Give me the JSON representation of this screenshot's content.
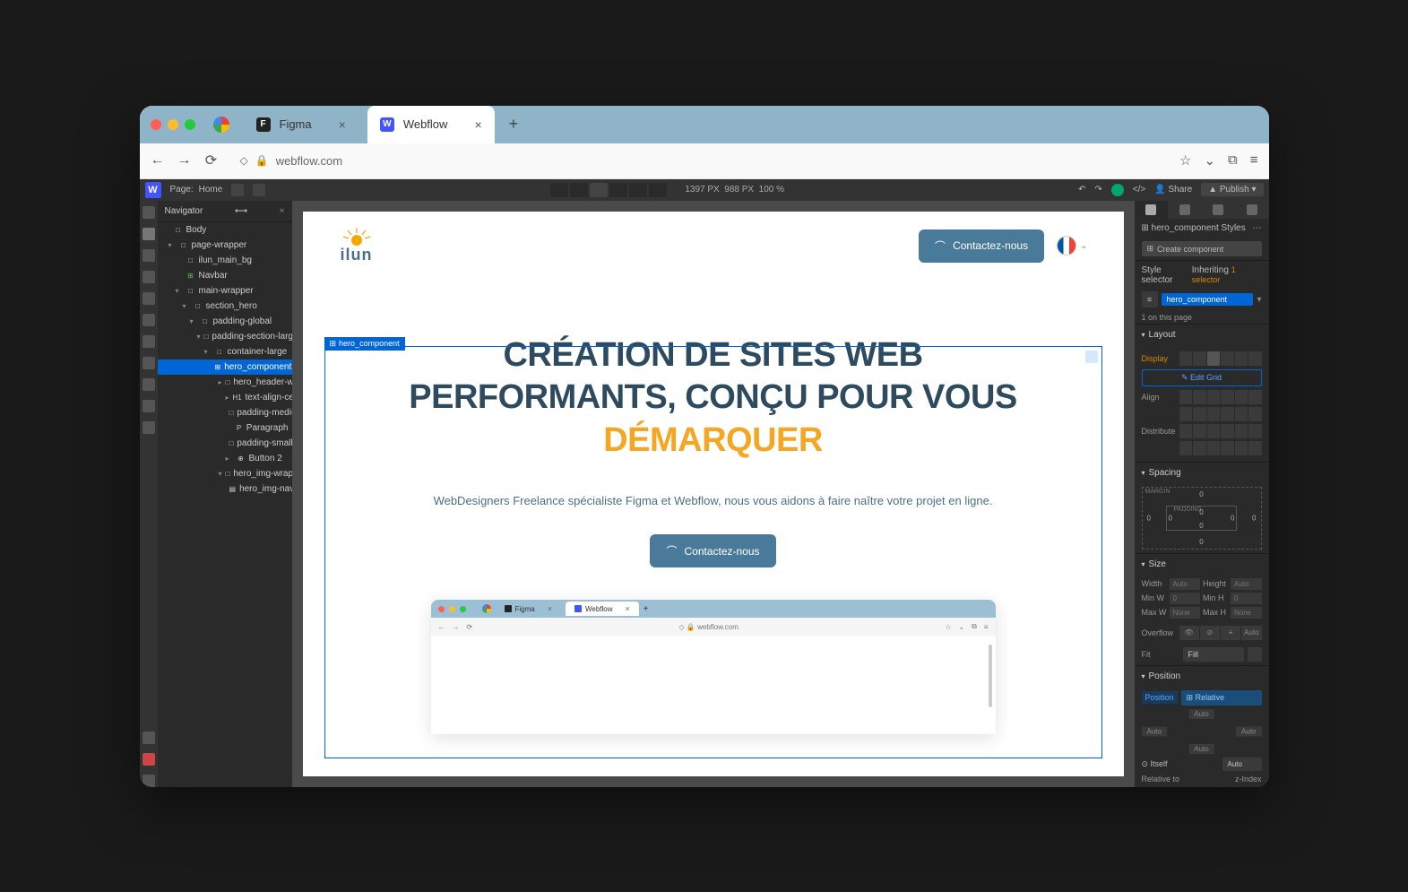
{
  "browser": {
    "tabs": [
      {
        "label": "Figma",
        "favicon_bg": "#222",
        "favicon_letter": "F",
        "active": false
      },
      {
        "label": "Webflow",
        "favicon_bg": "#4353ff",
        "favicon_letter": "W",
        "active": true
      }
    ],
    "url": "webflow.com"
  },
  "wf_topbar": {
    "page_label": "Page:",
    "page_name": "Home",
    "width": "1397",
    "px1": "PX",
    "height": "988",
    "px2": "PX",
    "zoom": "100",
    "pct": "%",
    "share": "Share",
    "publish": "Publish"
  },
  "navigator": {
    "title": "Navigator",
    "tree": [
      {
        "pad": 6,
        "icon": "□",
        "label": "Body"
      },
      {
        "pad": 12,
        "icon": "□",
        "label": "page-wrapper",
        "caret": "▾"
      },
      {
        "pad": 20,
        "icon": "□",
        "label": "ilun_main_bg"
      },
      {
        "pad": 20,
        "icon": "⊞",
        "label": "Navbar",
        "color": "#5fb85f"
      },
      {
        "pad": 20,
        "icon": "□",
        "label": "main-wrapper",
        "caret": "▾"
      },
      {
        "pad": 28,
        "icon": "□",
        "label": "section_hero",
        "caret": "▾"
      },
      {
        "pad": 36,
        "icon": "□",
        "label": "padding-global",
        "caret": "▾"
      },
      {
        "pad": 44,
        "icon": "□",
        "label": "padding-section-large",
        "caret": "▾"
      },
      {
        "pad": 52,
        "icon": "□",
        "label": "container-large",
        "caret": "▾"
      },
      {
        "pad": 60,
        "icon": "⊞",
        "label": "hero_component",
        "sel": true
      },
      {
        "pad": 68,
        "icon": "□",
        "label": "hero_header-wrapper",
        "caret": "▸"
      },
      {
        "pad": 76,
        "icon": "H1",
        "label": "text-align-center",
        "caret": "▸"
      },
      {
        "pad": 76,
        "icon": "□",
        "label": "padding-medium"
      },
      {
        "pad": 76,
        "icon": "P",
        "label": "Paragraph"
      },
      {
        "pad": 76,
        "icon": "□",
        "label": "padding-small"
      },
      {
        "pad": 76,
        "icon": "⊕",
        "label": "Button 2",
        "caret": "▸"
      },
      {
        "pad": 68,
        "icon": "□",
        "label": "hero_img-wrapper",
        "caret": "▾"
      },
      {
        "pad": 76,
        "icon": "▤",
        "label": "hero_img-navigator"
      }
    ]
  },
  "page_content": {
    "logo_text": "ilun",
    "cta": "Contactez-nous",
    "heading_line1": "CRÉATION DE SITES WEB",
    "heading_line2": "PERFORMANTS, CONÇU POUR VOUS",
    "heading_accent": "DÉMARQUER",
    "subheading": "WebDesigners Freelance spécialiste Figma et Webflow, nous vous aidons à faire naître votre projet en ligne.",
    "selection_label": "hero_component",
    "mini": {
      "tab1": "Figma",
      "tab2": "Webflow",
      "url": "webflow.com"
    }
  },
  "styles": {
    "panel_title": "hero_component Styles",
    "create_comp": "Create component",
    "style_selector": "Style selector",
    "inheriting": "Inheriting",
    "inheriting_count": "1 selector",
    "class_name": "hero_component",
    "on_page": "1 on this page",
    "sections": {
      "layout": "Layout",
      "spacing": "Spacing",
      "size": "Size",
      "position": "Position"
    },
    "display": "Display",
    "edit_grid": "Edit Grid",
    "align": "Align",
    "distribute": "Distribute",
    "margin": "MARGIN",
    "padding": "PADDING",
    "box_vals": {
      "top": "0",
      "right": "0",
      "bottom": "0",
      "left": "0",
      "ptop": "0",
      "pright": "0",
      "pbottom": "0",
      "pleft": "0"
    },
    "size": {
      "width": "Width",
      "height": "Height",
      "minw": "Min W",
      "minh": "Min H",
      "maxw": "Max W",
      "maxh": "Max H",
      "auto": "Auto",
      "none": "None",
      "zero": "0",
      "px": "PX"
    },
    "overflow": "Overflow",
    "ovf_auto": "Auto",
    "fit": "Fit",
    "fill": "Fill",
    "position": "Position",
    "relative": "Relative",
    "auto": "Auto",
    "itself": "Itself",
    "relative_to": "Relative to",
    "zindex": "z-Index"
  }
}
